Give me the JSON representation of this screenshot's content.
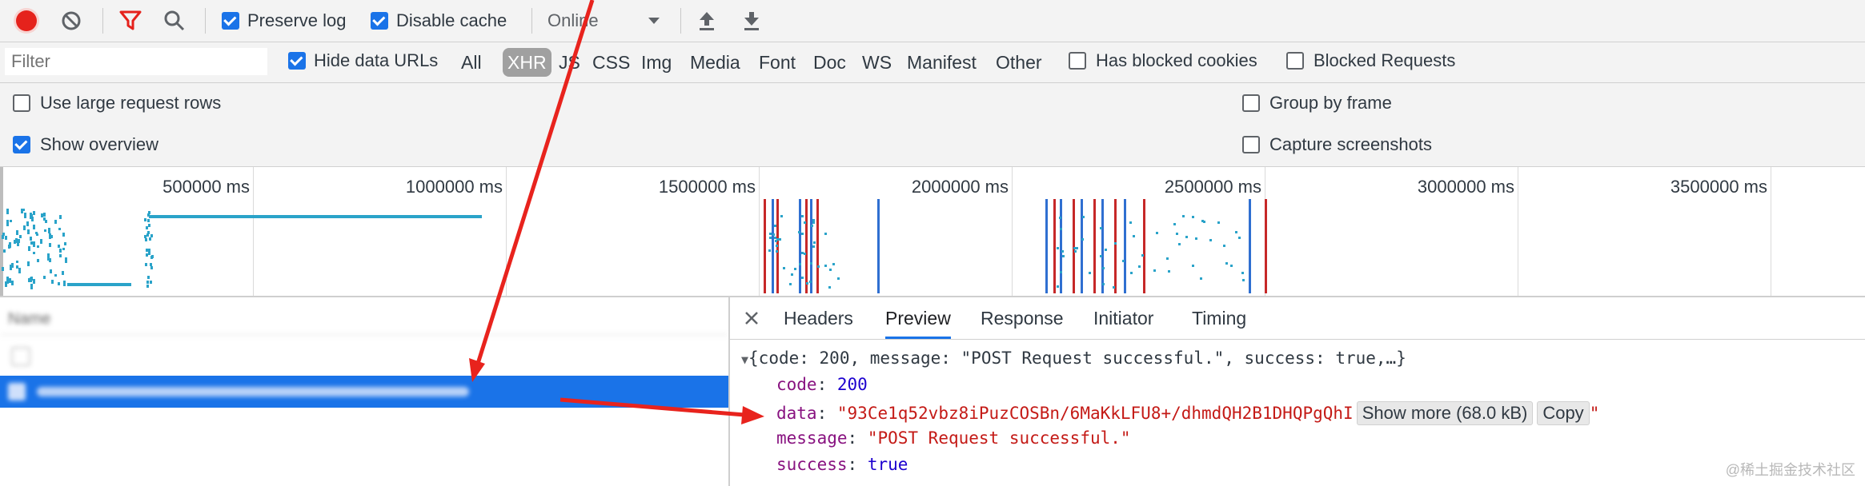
{
  "toolbar": {
    "record_icon": "record-icon",
    "clear_icon": "clear-icon",
    "filter_icon": "filter-icon",
    "search_icon": "search-icon",
    "preserve_log": "Preserve log",
    "disable_cache": "Disable cache",
    "throttle_value": "Online",
    "import_icon": "upload-icon",
    "export_icon": "download-icon"
  },
  "filter": {
    "placeholder": "Filter",
    "hide_data_urls": "Hide data URLs",
    "types": [
      "All",
      "XHR",
      "JS",
      "CSS",
      "Img",
      "Media",
      "Font",
      "Doc",
      "WS",
      "Manifest",
      "Other"
    ],
    "selected_type": "XHR",
    "has_blocked_cookies": "Has blocked cookies",
    "blocked_requests": "Blocked Requests"
  },
  "settings": {
    "large_rows": "Use large request rows",
    "show_overview": "Show overview",
    "group_by_frame": "Group by frame",
    "capture_screenshots": "Capture screenshots"
  },
  "overview": {
    "ticks": [
      "500000 ms",
      "1000000 ms",
      "1500000 ms",
      "2000000 ms",
      "2500000 ms",
      "3000000 ms",
      "3500000 ms"
    ]
  },
  "requests": {
    "name_header": "Name"
  },
  "details": {
    "close_icon": "close-icon",
    "tabs": [
      "Headers",
      "Preview",
      "Response",
      "Initiator",
      "Timing"
    ],
    "active_tab": "Preview",
    "summary": "{code: 200, message: \"POST Request successful.\", success: true,…}",
    "code_key": "code",
    "code_value": "200",
    "data_key": "data",
    "data_value": "93Ce1q52vbz8iPuzCOSBn/6MaKkLFU8+/dhmdQH2B1DHQPgQhI",
    "show_more": "Show more (68.0 kB)",
    "copy": "Copy",
    "message_key": "message",
    "message_value": "POST Request successful.",
    "success_key": "success",
    "success_value": "true"
  },
  "watermark": "@稀土掘金技术社区",
  "colors": {
    "accent": "#1a73e8",
    "record": "#e5221c",
    "arrow": "#e8231d"
  }
}
